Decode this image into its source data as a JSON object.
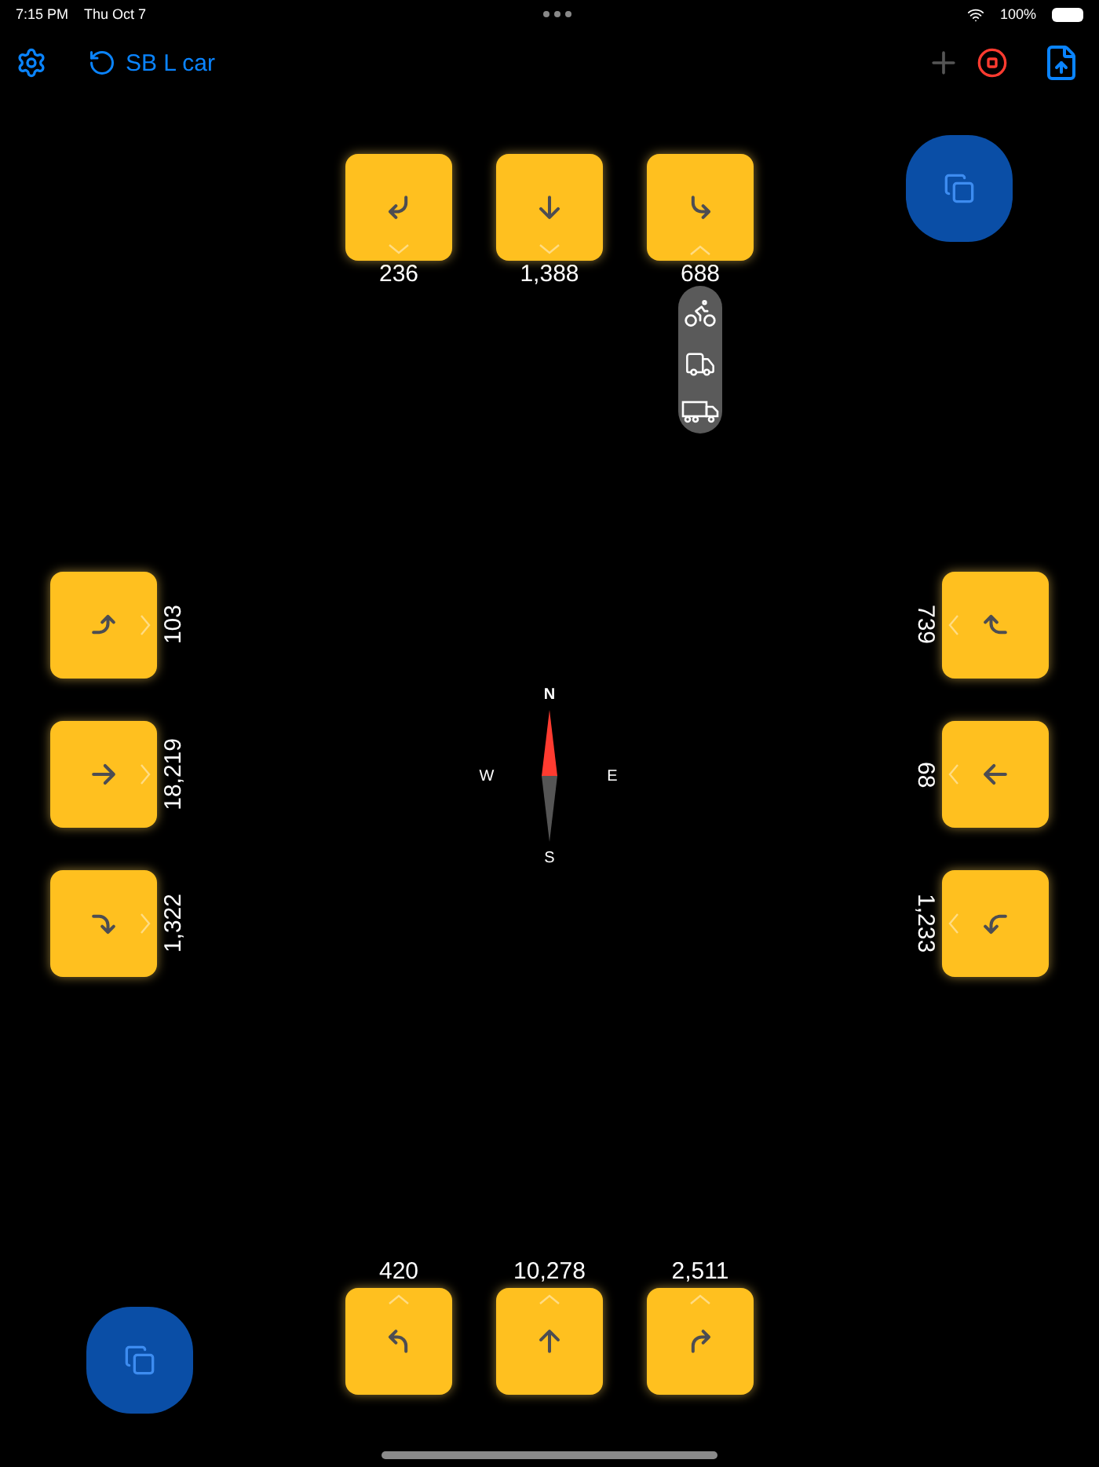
{
  "status_bar": {
    "time": "7:15 PM",
    "date": "Thu Oct 7",
    "battery": "100%"
  },
  "toolbar": {
    "title": "SB L car",
    "add_disabled": true
  },
  "approaches": [
    {
      "kind": "north",
      "movements": [
        {
          "kind": "right",
          "count": "236",
          "expanded": false
        },
        {
          "kind": "through",
          "count": "1,388",
          "expanded": false
        },
        {
          "kind": "left",
          "count": "688",
          "expanded": true
        }
      ]
    },
    {
      "kind": "west",
      "movements": [
        {
          "kind": "left",
          "count": "103",
          "expanded": false
        },
        {
          "kind": "through",
          "count": "18,219",
          "expanded": false
        },
        {
          "kind": "right",
          "count": "1,322",
          "expanded": false
        }
      ]
    },
    {
      "kind": "east",
      "movements": [
        {
          "kind": "right",
          "count": "739",
          "expanded": false
        },
        {
          "kind": "through",
          "count": "68",
          "expanded": false
        },
        {
          "kind": "left",
          "count": "1,233",
          "expanded": false
        }
      ]
    },
    {
      "kind": "south",
      "movements": [
        {
          "kind": "left",
          "count": "420",
          "expanded": false
        },
        {
          "kind": "through",
          "count": "10,278",
          "expanded": false
        },
        {
          "kind": "right",
          "count": "2,511",
          "expanded": false
        }
      ]
    }
  ],
  "vehicle_picker": {
    "options": [
      {
        "kind": "bicycle"
      },
      {
        "kind": "truck"
      },
      {
        "kind": "semi"
      }
    ]
  },
  "compass": {
    "north": "N",
    "east": "E",
    "south": "S",
    "west": "W"
  }
}
